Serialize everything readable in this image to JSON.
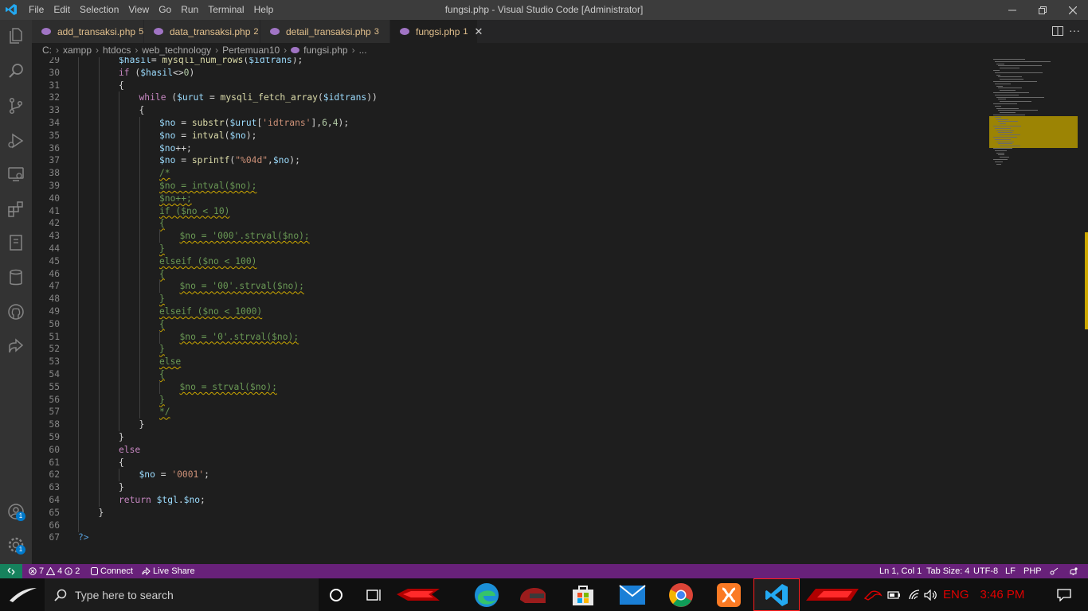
{
  "window": {
    "title": "fungsi.php - Visual Studio Code [Administrator]",
    "menu": [
      "File",
      "Edit",
      "Selection",
      "View",
      "Go",
      "Run",
      "Terminal",
      "Help"
    ],
    "controls": [
      "minimize-icon",
      "restore-icon",
      "close-icon"
    ]
  },
  "activity_bar": {
    "icons": [
      "explorer-icon",
      "search-icon",
      "source-control-icon",
      "run-debug-icon",
      "remote-explorer-icon",
      "extensions-icon",
      "book-icon",
      "database-icon",
      "github-icon",
      "live-share-icon"
    ],
    "accounts_badge": "1",
    "settings_badge": "1"
  },
  "tabs": [
    {
      "label": "add_transaksi.php",
      "count": "5",
      "active": false
    },
    {
      "label": "data_transaksi.php",
      "count": "2",
      "active": false
    },
    {
      "label": "detail_transaksi.php",
      "count": "3",
      "active": false
    },
    {
      "label": "fungsi.php",
      "count": "1",
      "active": true
    }
  ],
  "breadcrumb": [
    "C:",
    "xampp",
    "htdocs",
    "web_technology",
    "Pertemuan10",
    "fungsi.php",
    "..."
  ],
  "editor": {
    "lines": [
      {
        "n": "29",
        "indent": 2,
        "guides": 2,
        "warn": false,
        "tokens": [
          [
            "vr",
            "$hasil"
          ],
          [
            "",
            "="
          ],
          [
            "fn",
            " mysqli_num_rows"
          ],
          [
            "",
            "("
          ],
          [
            "vr",
            "$idtrans"
          ],
          [
            "",
            ");"
          ]
        ]
      },
      {
        "n": "30",
        "indent": 2,
        "guides": 2,
        "warn": false,
        "tokens": [
          [
            "kw",
            "if"
          ],
          [
            "",
            " ("
          ],
          [
            "vr",
            "$hasil"
          ],
          [
            "",
            "<>"
          ],
          [
            "nm",
            "0"
          ],
          [
            "",
            ")"
          ]
        ]
      },
      {
        "n": "31",
        "indent": 2,
        "guides": 2,
        "warn": false,
        "tokens": [
          [
            "",
            "{"
          ]
        ]
      },
      {
        "n": "32",
        "indent": 3,
        "guides": 3,
        "warn": false,
        "tokens": [
          [
            "kw",
            "while"
          ],
          [
            "",
            " ("
          ],
          [
            "vr",
            "$urut"
          ],
          [
            "",
            " = "
          ],
          [
            "fn",
            "mysqli_fetch_array"
          ],
          [
            "",
            "("
          ],
          [
            "vr",
            "$idtrans"
          ],
          [
            "",
            "))"
          ]
        ]
      },
      {
        "n": "33",
        "indent": 3,
        "guides": 3,
        "warn": false,
        "tokens": [
          [
            "",
            "{"
          ]
        ]
      },
      {
        "n": "34",
        "indent": 4,
        "guides": 4,
        "warn": false,
        "tokens": [
          [
            "vr",
            "$no"
          ],
          [
            "",
            " = "
          ],
          [
            "fn",
            "substr"
          ],
          [
            "",
            "("
          ],
          [
            "vr",
            "$urut"
          ],
          [
            "",
            "["
          ],
          [
            "st",
            "'idtrans'"
          ],
          [
            "",
            "],"
          ],
          [
            "nm",
            "6"
          ],
          [
            "",
            ","
          ],
          [
            "nm",
            "4"
          ],
          [
            "",
            ");"
          ]
        ]
      },
      {
        "n": "35",
        "indent": 4,
        "guides": 4,
        "warn": false,
        "tokens": [
          [
            "vr",
            "$no"
          ],
          [
            "",
            " = "
          ],
          [
            "fn",
            "intval"
          ],
          [
            "",
            "("
          ],
          [
            "vr",
            "$no"
          ],
          [
            "",
            ");"
          ]
        ]
      },
      {
        "n": "36",
        "indent": 4,
        "guides": 4,
        "warn": false,
        "tokens": [
          [
            "vr",
            "$no"
          ],
          [
            "",
            "++;"
          ]
        ]
      },
      {
        "n": "37",
        "indent": 4,
        "guides": 4,
        "warn": false,
        "tokens": [
          [
            "vr",
            "$no"
          ],
          [
            "",
            " = "
          ],
          [
            "fn",
            "sprintf"
          ],
          [
            "",
            "("
          ],
          [
            "st",
            "\"%04d\""
          ],
          [
            "",
            ","
          ],
          [
            "vr",
            "$no"
          ],
          [
            "",
            ");"
          ]
        ]
      },
      {
        "n": "38",
        "indent": 4,
        "guides": 4,
        "warn": true,
        "tokens": [
          [
            "cm",
            "/*"
          ]
        ]
      },
      {
        "n": "39",
        "indent": 4,
        "guides": 4,
        "warn": true,
        "tokens": [
          [
            "cm",
            "$no = intval($no);"
          ]
        ]
      },
      {
        "n": "40",
        "indent": 4,
        "guides": 4,
        "warn": true,
        "tokens": [
          [
            "cm",
            "$no++;"
          ]
        ]
      },
      {
        "n": "41",
        "indent": 4,
        "guides": 4,
        "warn": true,
        "tokens": [
          [
            "cm",
            "if ($no < 10)"
          ]
        ]
      },
      {
        "n": "42",
        "indent": 4,
        "guides": 4,
        "warn": true,
        "tokens": [
          [
            "cm",
            "{"
          ]
        ]
      },
      {
        "n": "43",
        "indent": 5,
        "guides": 5,
        "warn": true,
        "tokens": [
          [
            "cm",
            "$no = '000'.strval($no);"
          ]
        ]
      },
      {
        "n": "44",
        "indent": 4,
        "guides": 4,
        "warn": true,
        "tokens": [
          [
            "cm",
            "}"
          ]
        ]
      },
      {
        "n": "45",
        "indent": 4,
        "guides": 4,
        "warn": true,
        "tokens": [
          [
            "cm",
            "elseif ($no < 100)"
          ]
        ]
      },
      {
        "n": "46",
        "indent": 4,
        "guides": 4,
        "warn": true,
        "tokens": [
          [
            "cm",
            "{"
          ]
        ]
      },
      {
        "n": "47",
        "indent": 5,
        "guides": 5,
        "warn": true,
        "tokens": [
          [
            "cm",
            "$no = '00'.strval($no);"
          ]
        ]
      },
      {
        "n": "48",
        "indent": 4,
        "guides": 4,
        "warn": true,
        "tokens": [
          [
            "cm",
            "}"
          ]
        ]
      },
      {
        "n": "49",
        "indent": 4,
        "guides": 4,
        "warn": true,
        "tokens": [
          [
            "cm",
            "elseif ($no < 1000)"
          ]
        ]
      },
      {
        "n": "50",
        "indent": 4,
        "guides": 4,
        "warn": true,
        "tokens": [
          [
            "cm",
            "{"
          ]
        ]
      },
      {
        "n": "51",
        "indent": 5,
        "guides": 5,
        "warn": true,
        "tokens": [
          [
            "cm",
            "$no = '0'.strval($no);"
          ]
        ]
      },
      {
        "n": "52",
        "indent": 4,
        "guides": 4,
        "warn": true,
        "tokens": [
          [
            "cm",
            "}"
          ]
        ]
      },
      {
        "n": "53",
        "indent": 4,
        "guides": 4,
        "warn": true,
        "tokens": [
          [
            "cm",
            "else"
          ]
        ]
      },
      {
        "n": "54",
        "indent": 4,
        "guides": 4,
        "warn": true,
        "tokens": [
          [
            "cm",
            "{"
          ]
        ]
      },
      {
        "n": "55",
        "indent": 5,
        "guides": 5,
        "warn": true,
        "tokens": [
          [
            "cm",
            "$no = strval($no);"
          ]
        ]
      },
      {
        "n": "56",
        "indent": 4,
        "guides": 4,
        "warn": true,
        "tokens": [
          [
            "cm",
            "}"
          ]
        ]
      },
      {
        "n": "57",
        "indent": 4,
        "guides": 4,
        "warn": true,
        "tokens": [
          [
            "cm",
            "*/"
          ]
        ]
      },
      {
        "n": "58",
        "indent": 3,
        "guides": 3,
        "warn": false,
        "tokens": [
          [
            "",
            "}"
          ]
        ]
      },
      {
        "n": "59",
        "indent": 2,
        "guides": 2,
        "warn": false,
        "tokens": [
          [
            "",
            "}"
          ]
        ]
      },
      {
        "n": "60",
        "indent": 2,
        "guides": 2,
        "warn": false,
        "tokens": [
          [
            "kw",
            "else"
          ]
        ]
      },
      {
        "n": "61",
        "indent": 2,
        "guides": 2,
        "warn": false,
        "tokens": [
          [
            "",
            "{"
          ]
        ]
      },
      {
        "n": "62",
        "indent": 3,
        "guides": 3,
        "warn": false,
        "tokens": [
          [
            "vr",
            "$no"
          ],
          [
            "",
            " = "
          ],
          [
            "st",
            "'0001'"
          ],
          [
            "",
            ";"
          ]
        ]
      },
      {
        "n": "63",
        "indent": 2,
        "guides": 2,
        "warn": false,
        "tokens": [
          [
            "",
            "}"
          ]
        ]
      },
      {
        "n": "64",
        "indent": 2,
        "guides": 2,
        "warn": false,
        "tokens": [
          [
            "kw",
            "return"
          ],
          [
            "vr",
            " $tgl"
          ],
          [
            "",
            "."
          ],
          [
            "vr",
            "$no"
          ],
          [
            "",
            ";"
          ]
        ]
      },
      {
        "n": "65",
        "indent": 1,
        "guides": 1,
        "warn": false,
        "tokens": [
          [
            "",
            "}"
          ]
        ]
      },
      {
        "n": "66",
        "indent": 0,
        "guides": 1,
        "warn": false,
        "tokens": []
      },
      {
        "n": "67",
        "indent": 0,
        "guides": 0,
        "warn": false,
        "tokens": [
          [
            "tg",
            "?>"
          ]
        ]
      }
    ]
  },
  "status_bar": {
    "errors": "7",
    "warnings": "4",
    "infos": "2",
    "connect": "Connect",
    "live_share": "Live Share",
    "position": "Ln 1, Col 1",
    "tab_size": "Tab Size: 4",
    "encoding": "UTF-8",
    "eol": "LF",
    "language": "PHP"
  },
  "taskbar": {
    "search_placeholder": "Type here to search",
    "apps": [
      "edge-icon",
      "helmet-game-icon",
      "store-icon",
      "mail-icon",
      "chrome-icon",
      "xampp-icon",
      "vscode-icon"
    ],
    "language": "ENG",
    "time": "3:46 PM"
  },
  "colors": {
    "statusbar": "#68217a",
    "remote": "#16825d",
    "warning_squiggle": "#cca700",
    "tab_text_modified": "#e2c08d"
  }
}
